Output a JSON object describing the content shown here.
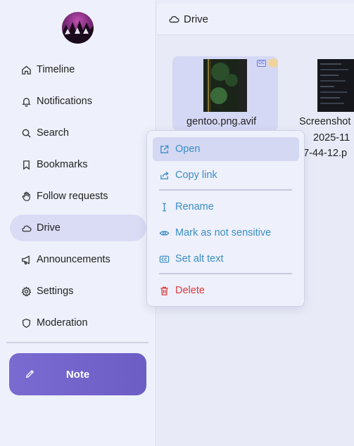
{
  "sidebar": {
    "items": [
      {
        "label": "Timeline",
        "icon": "home-icon"
      },
      {
        "label": "Notifications",
        "icon": "bell-icon"
      },
      {
        "label": "Search",
        "icon": "search-icon"
      },
      {
        "label": "Bookmarks",
        "icon": "bookmark-icon"
      },
      {
        "label": "Follow requests",
        "icon": "hand-icon"
      },
      {
        "label": "Drive",
        "icon": "cloud-icon",
        "active": true
      },
      {
        "label": "Announcements",
        "icon": "megaphone-icon"
      },
      {
        "label": "Settings",
        "icon": "gear-icon"
      },
      {
        "label": "Moderation",
        "icon": "shield-icon"
      }
    ],
    "note_label": "Note"
  },
  "header": {
    "title": "Drive"
  },
  "files": [
    {
      "name": "gentoo.png.avif",
      "selected": true,
      "has_alt_text": true,
      "sensitive": true
    },
    {
      "name_lines": [
        "Screenshot",
        "2025-11",
        "7-44-12.p"
      ]
    }
  ],
  "context_menu": {
    "items": [
      {
        "label": "Open",
        "icon": "external-link-icon"
      },
      {
        "label": "Copy link",
        "icon": "share-icon"
      },
      {
        "label": "Rename",
        "icon": "text-cursor-icon"
      },
      {
        "label": "Mark as not sensitive",
        "icon": "eye-icon"
      },
      {
        "label": "Set alt text",
        "icon": "cc-icon"
      },
      {
        "label": "Delete",
        "icon": "trash-icon"
      }
    ]
  },
  "colors": {
    "accent": "#6c5dc5",
    "menu_text": "#3b8ec4",
    "danger": "#dc3b3b",
    "background": "#eef1fb"
  }
}
